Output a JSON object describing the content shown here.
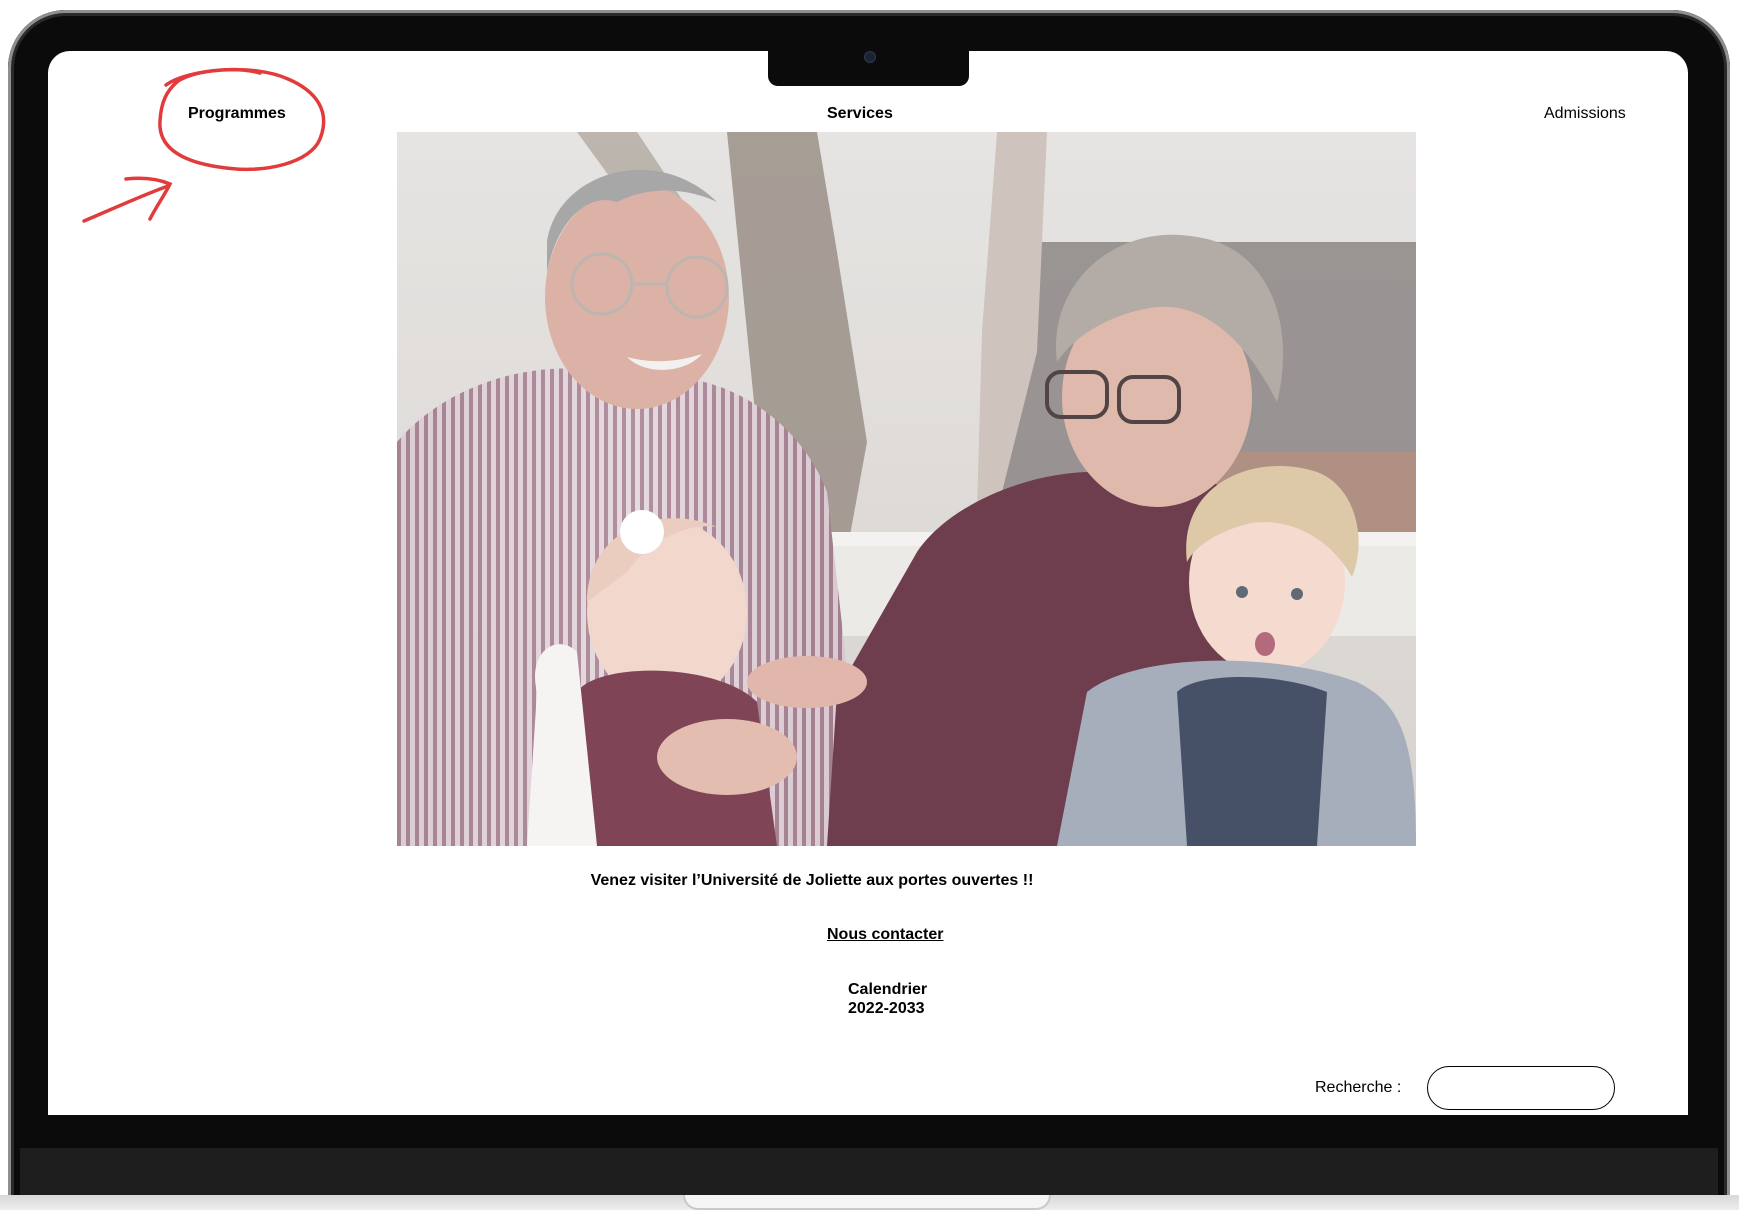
{
  "nav": {
    "programmes": "Programmes",
    "services": "Services",
    "admissions": "Admissions"
  },
  "hero": {
    "description": "photo-grandparents-with-babies"
  },
  "main": {
    "headline": "Venez visiter l’Université de Joliette aux portes ouvertes !!",
    "contact_link": "Nous contacter",
    "calendar_line1": "Calendrier",
    "calendar_line2": "2022-2033"
  },
  "search": {
    "label": "Recherche :",
    "value": "",
    "placeholder": ""
  },
  "colors": {
    "annotation_red": "#e23b3b",
    "device_frame": "#0b0b0b",
    "screen_bg": "#ffffff"
  }
}
